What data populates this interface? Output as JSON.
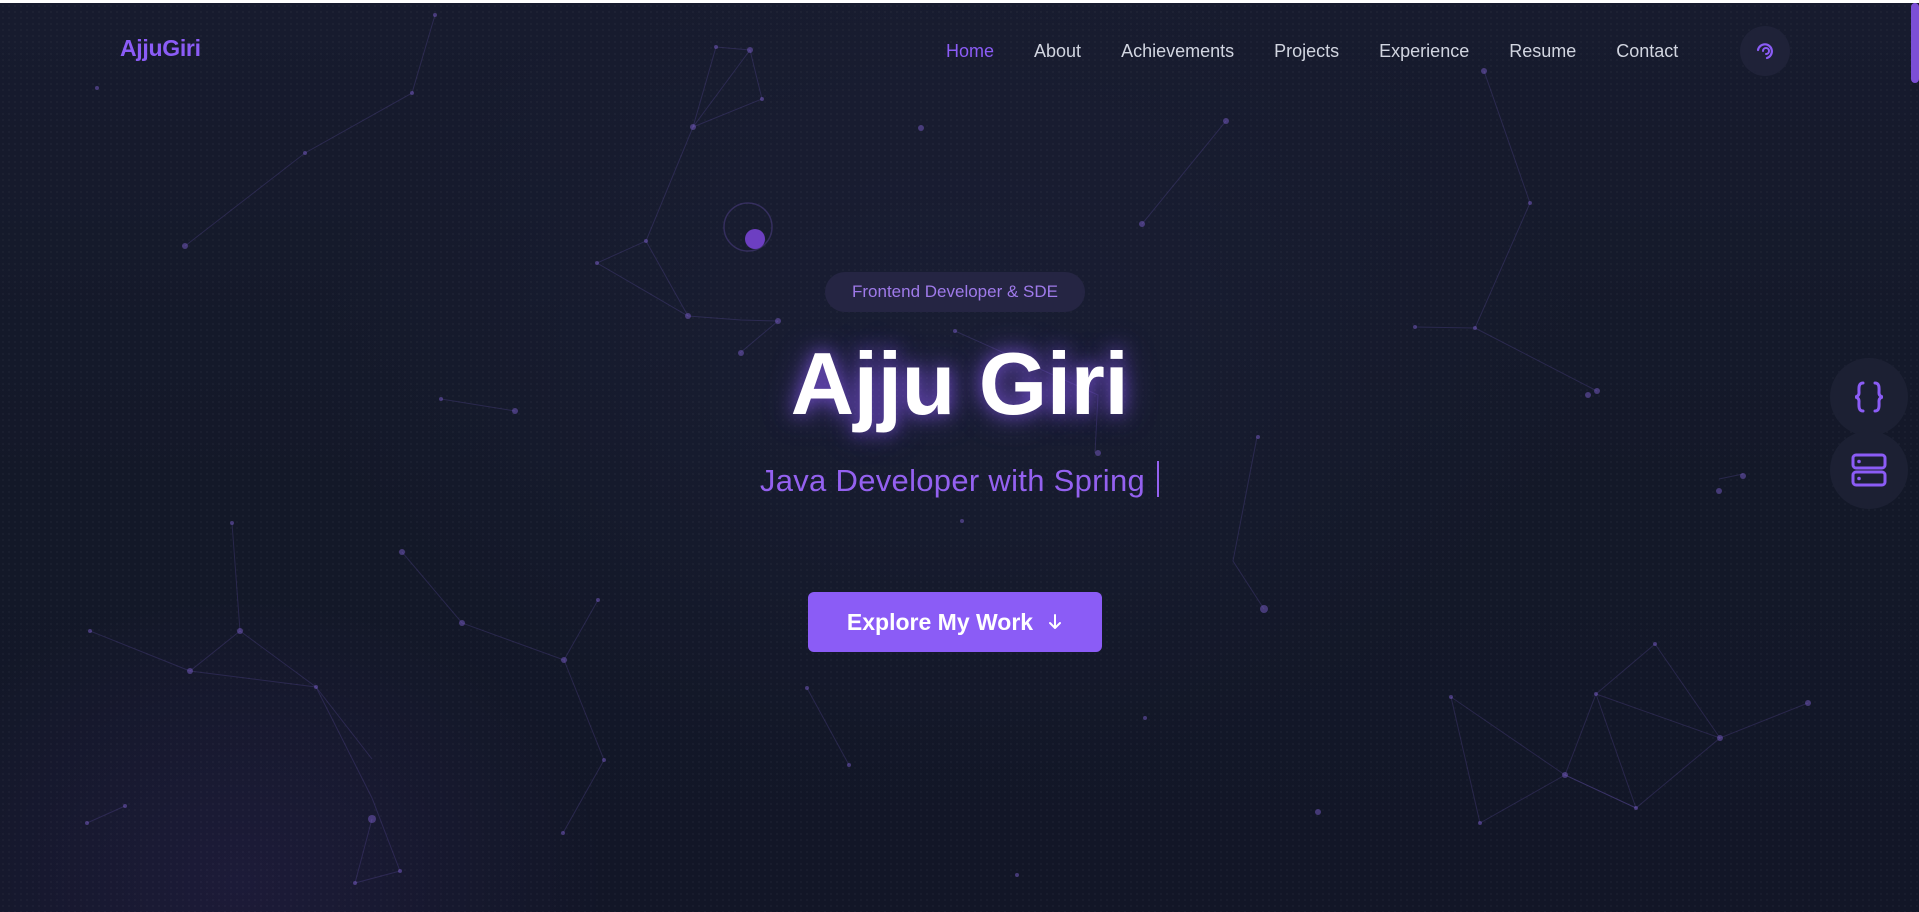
{
  "brand": {
    "part1": "Ajju",
    "part2": "Giri"
  },
  "nav": {
    "items": [
      {
        "label": "Home",
        "active": true
      },
      {
        "label": "About",
        "active": false
      },
      {
        "label": "Achievements",
        "active": false
      },
      {
        "label": "Projects",
        "active": false
      },
      {
        "label": "Experience",
        "active": false
      },
      {
        "label": "Resume",
        "active": false
      },
      {
        "label": "Contact",
        "active": false
      }
    ],
    "theme_toggle_icon": "half-moon-icon"
  },
  "hero": {
    "tag": "Frontend Developer & SDE",
    "name": "Ajju Giri",
    "role": "Java Developer with Spring",
    "cta_label": "Explore My Work",
    "cta_icon": "arrow-down-icon"
  },
  "side_buttons": [
    {
      "icon": "curly-braces-icon"
    },
    {
      "icon": "server-icon"
    }
  ],
  "colors": {
    "accent": "#8b5cf6",
    "background": "#131828",
    "nav_text": "#d1d5e0",
    "heading": "#ffffff"
  }
}
